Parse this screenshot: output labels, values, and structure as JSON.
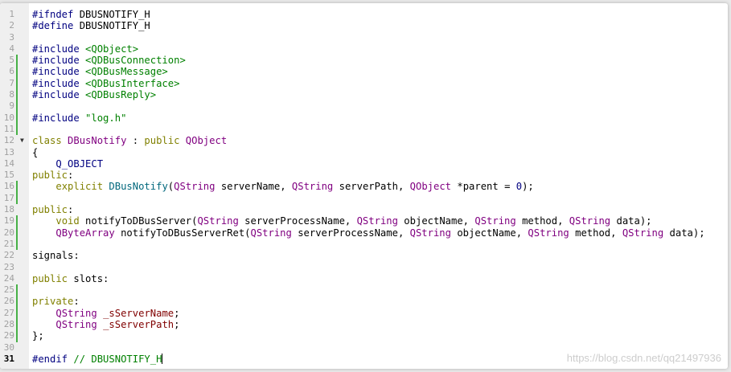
{
  "editor": {
    "current_line": 31,
    "lines": [
      {
        "n": "1",
        "change": "",
        "tokens": [
          [
            "pp",
            "#ifndef"
          ],
          [
            "plain",
            " DBUSNOTIFY_H"
          ]
        ]
      },
      {
        "n": "2",
        "change": "",
        "tokens": [
          [
            "pp",
            "#define"
          ],
          [
            "plain",
            " DBUSNOTIFY_H"
          ]
        ]
      },
      {
        "n": "3",
        "change": "",
        "tokens": []
      },
      {
        "n": "4",
        "change": "",
        "tokens": [
          [
            "pp",
            "#include"
          ],
          [
            "plain",
            " "
          ],
          [
            "str",
            "<QObject>"
          ]
        ]
      },
      {
        "n": "5",
        "change": "mod",
        "tokens": [
          [
            "pp",
            "#include"
          ],
          [
            "plain",
            " "
          ],
          [
            "str",
            "<QDBusConnection>"
          ]
        ]
      },
      {
        "n": "6",
        "change": "mod",
        "tokens": [
          [
            "pp",
            "#include"
          ],
          [
            "plain",
            " "
          ],
          [
            "str",
            "<QDBusMessage>"
          ]
        ]
      },
      {
        "n": "7",
        "change": "mod",
        "tokens": [
          [
            "pp",
            "#include"
          ],
          [
            "plain",
            " "
          ],
          [
            "str",
            "<QDBusInterface>"
          ]
        ]
      },
      {
        "n": "8",
        "change": "mod",
        "tokens": [
          [
            "pp",
            "#include"
          ],
          [
            "plain",
            " "
          ],
          [
            "str",
            "<QDBusReply>"
          ]
        ]
      },
      {
        "n": "9",
        "change": "mod",
        "tokens": []
      },
      {
        "n": "10",
        "change": "mod",
        "tokens": [
          [
            "pp",
            "#include"
          ],
          [
            "plain",
            " "
          ],
          [
            "str",
            "\"log.h\""
          ]
        ]
      },
      {
        "n": "11",
        "change": "mod",
        "tokens": []
      },
      {
        "n": "12",
        "change": "",
        "fold": true,
        "tokens": [
          [
            "kw",
            "class"
          ],
          [
            "plain",
            " "
          ],
          [
            "type",
            "DBusNotify"
          ],
          [
            "plain",
            " : "
          ],
          [
            "kw",
            "public"
          ],
          [
            "plain",
            " "
          ],
          [
            "type",
            "QObject"
          ]
        ]
      },
      {
        "n": "13",
        "change": "",
        "tokens": [
          [
            "plain",
            "{"
          ]
        ]
      },
      {
        "n": "14",
        "change": "",
        "tokens": [
          [
            "plain",
            "    "
          ],
          [
            "macro",
            "Q_OBJECT"
          ]
        ]
      },
      {
        "n": "15",
        "change": "",
        "tokens": [
          [
            "kw",
            "public"
          ],
          [
            "plain",
            ":"
          ]
        ]
      },
      {
        "n": "16",
        "change": "mod",
        "tokens": [
          [
            "plain",
            "    "
          ],
          [
            "kw",
            "explicit"
          ],
          [
            "plain",
            " "
          ],
          [
            "fn",
            "DBusNotify"
          ],
          [
            "plain",
            "("
          ],
          [
            "type",
            "QString"
          ],
          [
            "plain",
            " serverName, "
          ],
          [
            "type",
            "QString"
          ],
          [
            "plain",
            " serverPath, "
          ],
          [
            "type",
            "QObject"
          ],
          [
            "plain",
            " *parent = "
          ],
          [
            "num",
            "0"
          ],
          [
            "plain",
            ");"
          ]
        ]
      },
      {
        "n": "17",
        "change": "mod",
        "tokens": []
      },
      {
        "n": "18",
        "change": "",
        "tokens": [
          [
            "kw",
            "public"
          ],
          [
            "plain",
            ":"
          ]
        ]
      },
      {
        "n": "19",
        "change": "mod",
        "tokens": [
          [
            "plain",
            "    "
          ],
          [
            "kw",
            "void"
          ],
          [
            "plain",
            " notifyToDBusServer("
          ],
          [
            "type",
            "QString"
          ],
          [
            "plain",
            " serverProcessName, "
          ],
          [
            "type",
            "QString"
          ],
          [
            "plain",
            " objectName, "
          ],
          [
            "type",
            "QString"
          ],
          [
            "plain",
            " method, "
          ],
          [
            "type",
            "QString"
          ],
          [
            "plain",
            " data);"
          ]
        ]
      },
      {
        "n": "20",
        "change": "mod",
        "tokens": [
          [
            "plain",
            "    "
          ],
          [
            "type",
            "QByteArray"
          ],
          [
            "plain",
            " notifyToDBusServerRet("
          ],
          [
            "type",
            "QString"
          ],
          [
            "plain",
            " serverProcessName, "
          ],
          [
            "type",
            "QString"
          ],
          [
            "plain",
            " objectName, "
          ],
          [
            "type",
            "QString"
          ],
          [
            "plain",
            " method, "
          ],
          [
            "type",
            "QString"
          ],
          [
            "plain",
            " data);"
          ]
        ]
      },
      {
        "n": "21",
        "change": "mod",
        "tokens": []
      },
      {
        "n": "22",
        "change": "",
        "tokens": [
          [
            "plain",
            "signals:"
          ]
        ]
      },
      {
        "n": "23",
        "change": "",
        "tokens": []
      },
      {
        "n": "24",
        "change": "",
        "tokens": [
          [
            "kw",
            "public"
          ],
          [
            "plain",
            " slots:"
          ]
        ]
      },
      {
        "n": "25",
        "change": "mod",
        "tokens": []
      },
      {
        "n": "26",
        "change": "mod",
        "tokens": [
          [
            "kw",
            "private"
          ],
          [
            "plain",
            ":"
          ]
        ]
      },
      {
        "n": "27",
        "change": "mod",
        "tokens": [
          [
            "plain",
            "    "
          ],
          [
            "type",
            "QString"
          ],
          [
            "plain",
            " "
          ],
          [
            "field",
            "_sServerName"
          ],
          [
            "plain",
            ";"
          ]
        ]
      },
      {
        "n": "28",
        "change": "mod",
        "tokens": [
          [
            "plain",
            "    "
          ],
          [
            "type",
            "QString"
          ],
          [
            "plain",
            " "
          ],
          [
            "field",
            "_sServerPath"
          ],
          [
            "plain",
            ";"
          ]
        ]
      },
      {
        "n": "29",
        "change": "mod",
        "tokens": [
          [
            "plain",
            "};"
          ]
        ]
      },
      {
        "n": "30",
        "change": "",
        "tokens": []
      },
      {
        "n": "31",
        "change": "",
        "cursor": true,
        "tokens": [
          [
            "pp",
            "#endif"
          ],
          [
            "plain",
            " "
          ],
          [
            "com",
            "// DBUSNOTIFY_H"
          ]
        ]
      }
    ]
  },
  "watermark": "https://blog.csdn.net/qq21497936"
}
